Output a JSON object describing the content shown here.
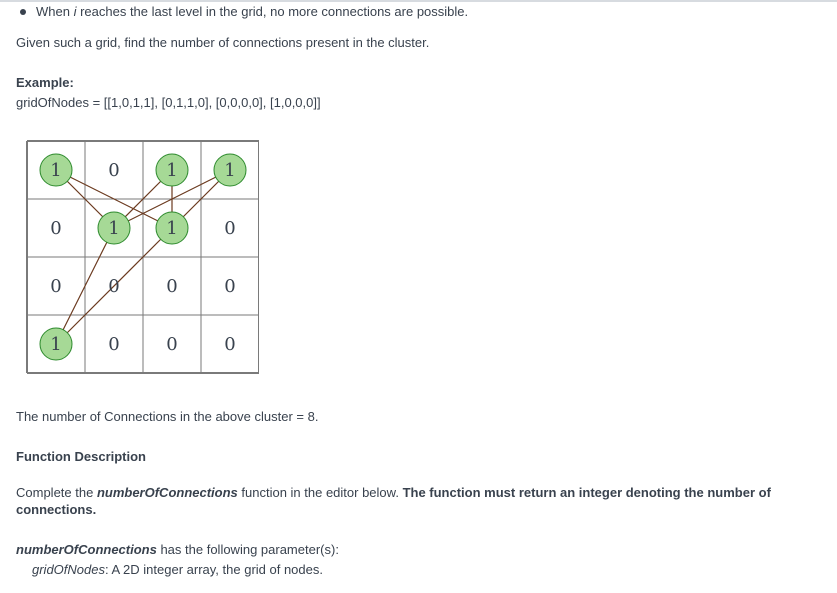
{
  "bullet": {
    "prefix": "When ",
    "var": "i",
    "suffix": " reaches the last level in the grid, no more connections are possible."
  },
  "intro": "Given such a grid, find the number of connections present in the cluster.",
  "example": {
    "heading": "Example:",
    "input": "gridOfNodes = [[1,0,1,1], [0,1,1,0], [0,0,0,0], [1,0,0,0]]"
  },
  "grid": {
    "rows": [
      [
        "1",
        "0",
        "1",
        "1"
      ],
      [
        "0",
        "1",
        "1",
        "0"
      ],
      [
        "0",
        "0",
        "0",
        "0"
      ],
      [
        "1",
        "0",
        "0",
        "0"
      ]
    ],
    "node_fill": "#a6d996",
    "node_stroke": "#2e8b2e",
    "edge_color": "#6b3a1f",
    "grid_color": "#7a7a7a"
  },
  "result": "The number of Connections in the above cluster = 8.",
  "function_description": {
    "heading": "Function Description",
    "text_prefix": "Complete the ",
    "fn_name": "numberOfConnections",
    "text_middle": " function in the editor below. ",
    "bold_text": "The function must return an integer denoting the number of connections."
  },
  "parameters": {
    "fn_name": "numberOfConnections",
    "text": " has the following parameter(s):",
    "param_name": "gridOfNodes",
    "param_desc": ": A 2D integer array, the grid of nodes."
  }
}
